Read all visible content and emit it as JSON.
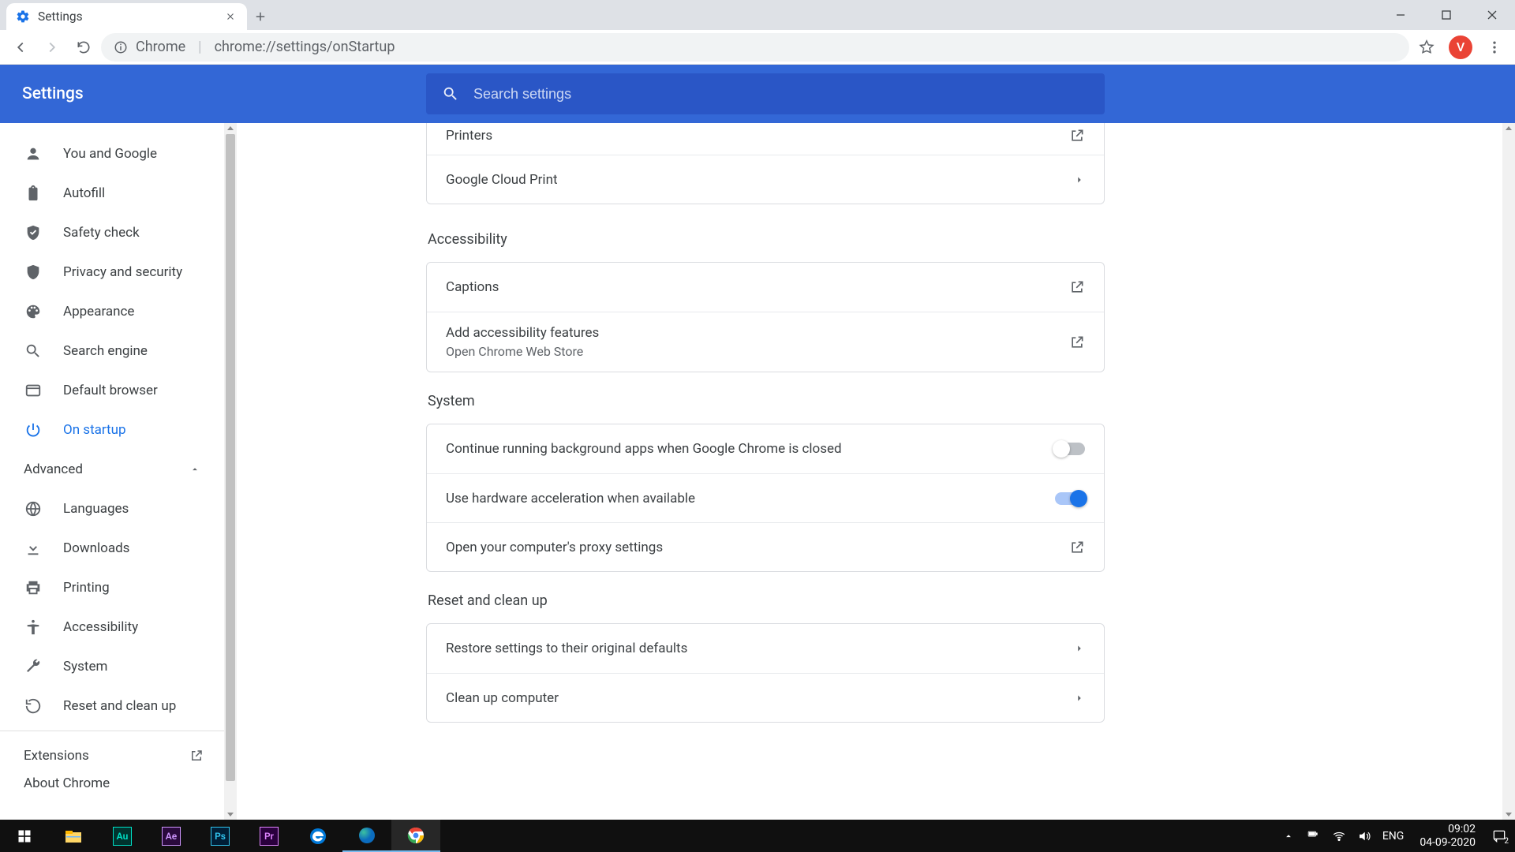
{
  "window": {
    "tab_title": "Settings",
    "avatar_letter": "V"
  },
  "omnibox": {
    "chrome_label": "Chrome",
    "url": "chrome://settings/onStartup"
  },
  "header": {
    "title": "Settings",
    "search_placeholder": "Search settings"
  },
  "sidebar": {
    "items": [
      {
        "label": "You and Google"
      },
      {
        "label": "Autofill"
      },
      {
        "label": "Safety check"
      },
      {
        "label": "Privacy and security"
      },
      {
        "label": "Appearance"
      },
      {
        "label": "Search engine"
      },
      {
        "label": "Default browser"
      },
      {
        "label": "On startup"
      }
    ],
    "advanced_label": "Advanced",
    "advanced_items": [
      {
        "label": "Languages"
      },
      {
        "label": "Downloads"
      },
      {
        "label": "Printing"
      },
      {
        "label": "Accessibility"
      },
      {
        "label": "System"
      },
      {
        "label": "Reset and clean up"
      }
    ],
    "extensions_label": "Extensions",
    "about_label": "About Chrome"
  },
  "content": {
    "printing_rows": {
      "printers": "Printers",
      "gcp": "Google Cloud Print"
    },
    "accessibility": {
      "title": "Accessibility",
      "captions": "Captions",
      "add_title": "Add accessibility features",
      "add_sub": "Open Chrome Web Store"
    },
    "system": {
      "title": "System",
      "bg_apps": "Continue running background apps when Google Chrome is closed",
      "hw_accel": "Use hardware acceleration when available",
      "proxy": "Open your computer's proxy settings"
    },
    "reset": {
      "title": "Reset and clean up",
      "restore": "Restore settings to their original defaults",
      "cleanup": "Clean up computer"
    }
  },
  "taskbar": {
    "lang": "ENG",
    "time": "09:02",
    "date": "04-09-2020",
    "notif_count": "2"
  }
}
